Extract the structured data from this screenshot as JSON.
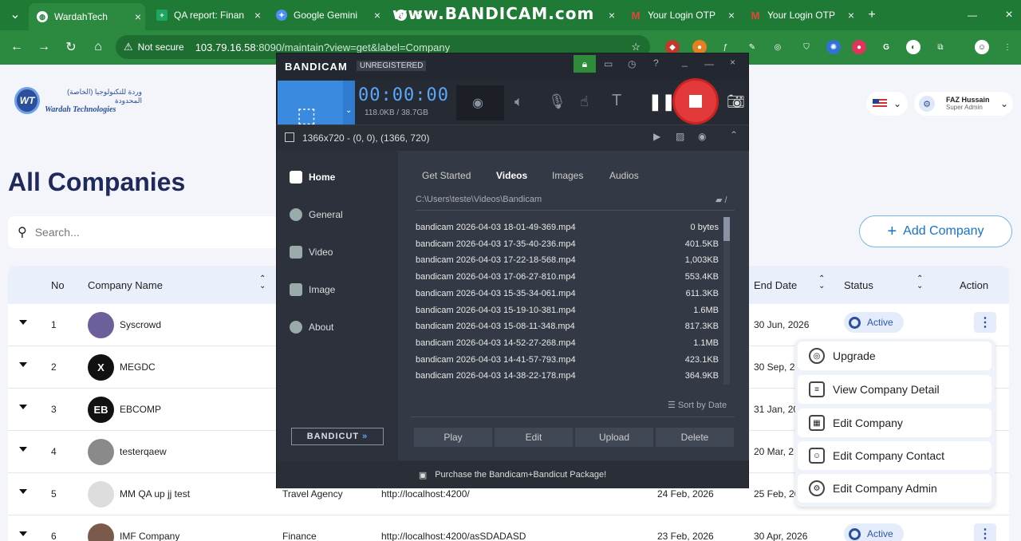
{
  "browser": {
    "tabs": [
      {
        "label": "WardahTech",
        "fav_color": "#ffffff",
        "active": true
      },
      {
        "label": "QA report: Finan",
        "fav_color": "#1fa463"
      },
      {
        "label": "Google Gemini",
        "fav_color": "#4f8ef7"
      },
      {
        "label": "IS",
        "fav_color": "#ffffff"
      },
      {
        "label": "Your Login OTP",
        "fav_color": "#ea4335"
      },
      {
        "label": "Your Login OTP",
        "fav_color": "#ea4335"
      }
    ],
    "new_tab": "+",
    "security": "Not secure",
    "url_host": "103.79.16.58",
    "url_rest": ":8090/maintain?view=get&label=Company"
  },
  "watermark": "www.BANDICAM.com",
  "app": {
    "logo_initials": "WT",
    "logo_arabic": "وردة للتكنولوجيا (الخاصة) المحدودة",
    "logo_name": "Wardah Technologies",
    "user_name": "FAZ Hussain",
    "user_role": "Super Admin",
    "page_title": "All Companies",
    "search_placeholder": "Search...",
    "add_button": "Add Company",
    "columns": {
      "no": "No",
      "name": "Company Name",
      "end": "End Date",
      "status": "Status",
      "action": "Action"
    },
    "rows": [
      {
        "no": "1",
        "name": "Syscrowd",
        "type": "",
        "url": "",
        "start": "",
        "end": "30 Jun, 2026",
        "status": "Active",
        "avatar": "",
        "avatar_color": "#6c5f9a"
      },
      {
        "no": "2",
        "name": "MEGDC",
        "type": "",
        "url": "",
        "start": "",
        "end": "30 Sep, 2",
        "status": "",
        "avatar": "X",
        "avatar_color": "#111111"
      },
      {
        "no": "3",
        "name": "EBCOMP",
        "type": "",
        "url": "",
        "start": "",
        "end": "31 Jan, 20",
        "status": "",
        "avatar": "EB",
        "avatar_color": "#111111"
      },
      {
        "no": "4",
        "name": "testerqaew",
        "type": "",
        "url": "",
        "start": "",
        "end": "20 Mar, 2",
        "status": "",
        "avatar": "",
        "avatar_color": "#8a8a8a"
      },
      {
        "no": "5",
        "name": "MM QA up jj test",
        "type": "Travel Agency",
        "url": "http://localhost:4200/",
        "start": "24 Feb, 2026",
        "end": "25 Feb, 20",
        "status": "",
        "avatar": "",
        "avatar_color": "#dddddd"
      },
      {
        "no": "6",
        "name": "IMF Company",
        "type": "Finance",
        "url": "http://localhost:4200/asSDADASD",
        "start": "23 Feb, 2026",
        "end": "30 Apr, 2026",
        "status": "Active",
        "avatar": "",
        "avatar_color": "#7a5a4a"
      }
    ],
    "menu": [
      "Upgrade",
      "View Company Detail",
      "Edit Company",
      "Edit Company Contact",
      "Edit Company Admin"
    ]
  },
  "bandicam": {
    "brand": "BANDICAM",
    "badge": "UNREGISTERED",
    "timer": "00:00:00",
    "size": "118.0KB / 38.7GB",
    "resolution": "1366x720 - (0, 0), (1366, 720)",
    "nav": [
      "Home",
      "General",
      "Video",
      "Image",
      "About"
    ],
    "tabs": [
      "Get Started",
      "Videos",
      "Images",
      "Audios"
    ],
    "path": "C:\\Users\\teste\\Videos\\Bandicam",
    "files": [
      {
        "name": "bandicam 2026-04-03 18-01-49-369.mp4",
        "size": "0 bytes"
      },
      {
        "name": "bandicam 2026-04-03 17-35-40-236.mp4",
        "size": "401.5KB"
      },
      {
        "name": "bandicam 2026-04-03 17-22-18-568.mp4",
        "size": "1,003KB"
      },
      {
        "name": "bandicam 2026-04-03 17-06-27-810.mp4",
        "size": "553.4KB"
      },
      {
        "name": "bandicam 2026-04-03 15-35-34-061.mp4",
        "size": "611.3KB"
      },
      {
        "name": "bandicam 2026-04-03 15-19-10-381.mp4",
        "size": "1.6MB"
      },
      {
        "name": "bandicam 2026-04-03 15-08-11-348.mp4",
        "size": "817.3KB"
      },
      {
        "name": "bandicam 2026-04-03 14-52-27-268.mp4",
        "size": "1.1MB"
      },
      {
        "name": "bandicam 2026-04-03 14-41-57-793.mp4",
        "size": "423.1KB"
      },
      {
        "name": "bandicam 2026-04-03 14-38-22-178.mp4",
        "size": "364.9KB"
      }
    ],
    "sort": "Sort by Date",
    "bandicut": "BANDICUT",
    "buttons": [
      "Play",
      "Edit",
      "Upload",
      "Delete"
    ],
    "footer": "Purchase the Bandicam+Bandicut Package!"
  }
}
